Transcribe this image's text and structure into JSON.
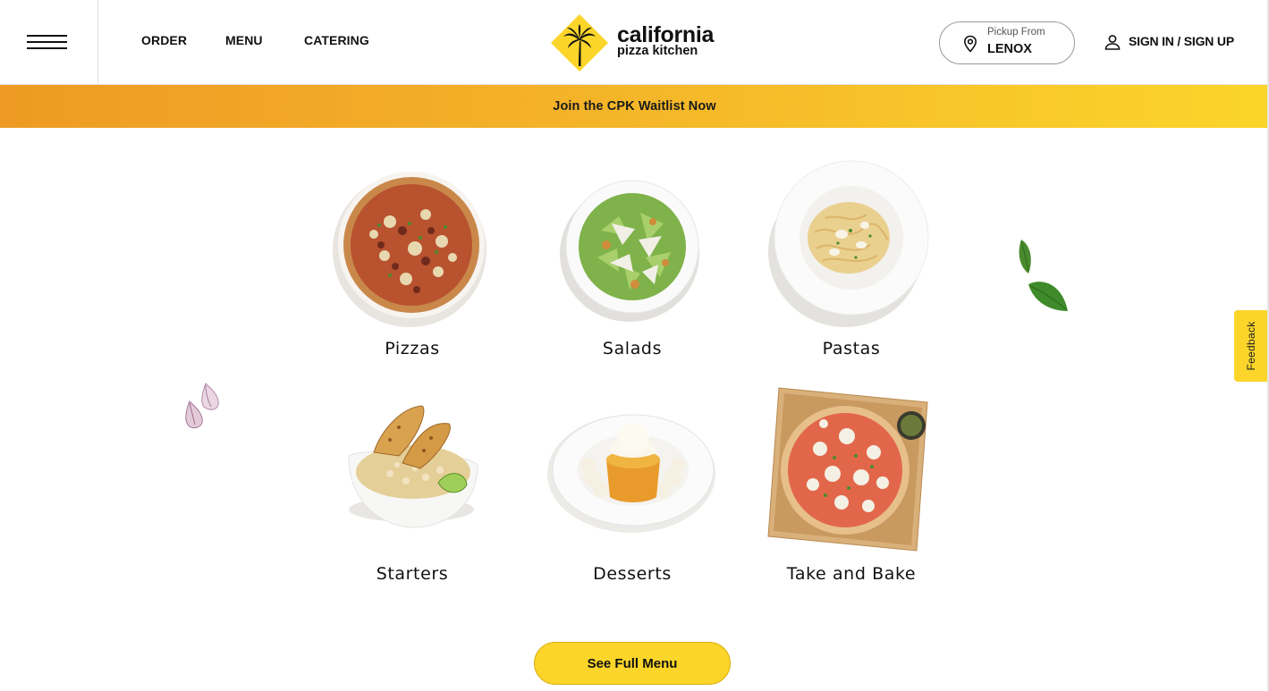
{
  "header": {
    "nav": {
      "order": "ORDER",
      "menu": "MENU",
      "catering": "CATERING"
    },
    "logo": {
      "line1": "california",
      "line2": "pizza kitchen"
    },
    "pickup": {
      "label": "Pickup From",
      "value": "LENOX"
    },
    "signin": "SIGN IN / SIGN UP"
  },
  "banner": {
    "text": "Join the CPK Waitlist Now"
  },
  "categories": [
    {
      "label": "Pizzas"
    },
    {
      "label": "Salads"
    },
    {
      "label": "Pastas"
    },
    {
      "label": "Starters"
    },
    {
      "label": "Desserts"
    },
    {
      "label": "Take and Bake"
    }
  ],
  "cta": {
    "label": "See Full Menu"
  },
  "feedback": {
    "label": "Feedback"
  },
  "colors": {
    "brand_yellow": "#fbd52a",
    "banner_orange": "#ee9a24",
    "text": "#111111"
  }
}
